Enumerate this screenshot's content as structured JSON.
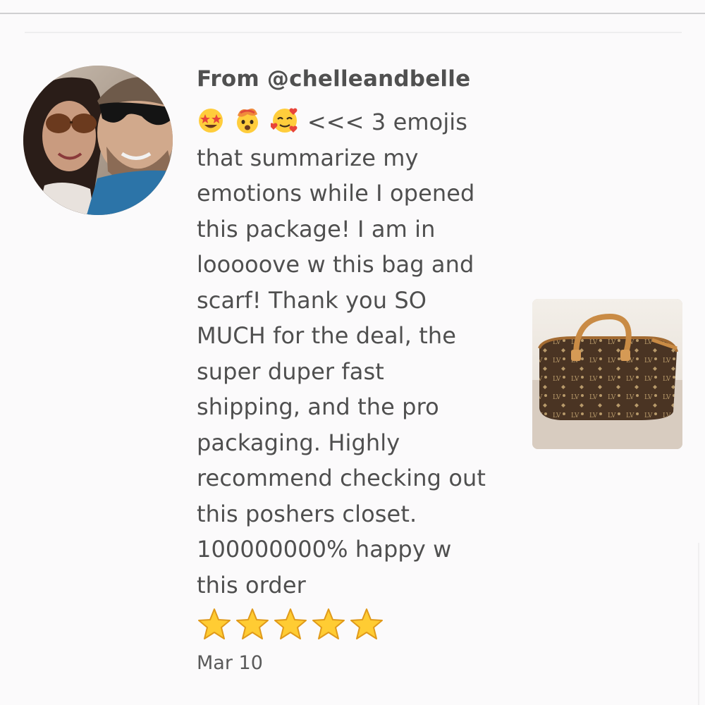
{
  "review": {
    "author": "From @chelleandbelle",
    "emojis": [
      "star-struck-emoji",
      "exploding-head-emoji",
      "smiling-face-with-hearts-emoji"
    ],
    "comment": "<<< 3 emojis that summarize my emotions while I opened this package! I am in looooove w this bag and scarf! Thank you SO MUCH for the deal, the super duper fast shipping, and the pro packaging. Highly recommend checking out this poshers closet. 100000000% happy w this order",
    "rating": 5,
    "star_icon": "star-emoji",
    "date": "Mar 10"
  },
  "avatar": {
    "icon": "user-avatar-photo"
  },
  "product": {
    "icon": "monogram-handbag-photo"
  },
  "colors": {
    "background": "#fbfafb",
    "text": "#4f4f4f",
    "star": "#ffcc33"
  }
}
